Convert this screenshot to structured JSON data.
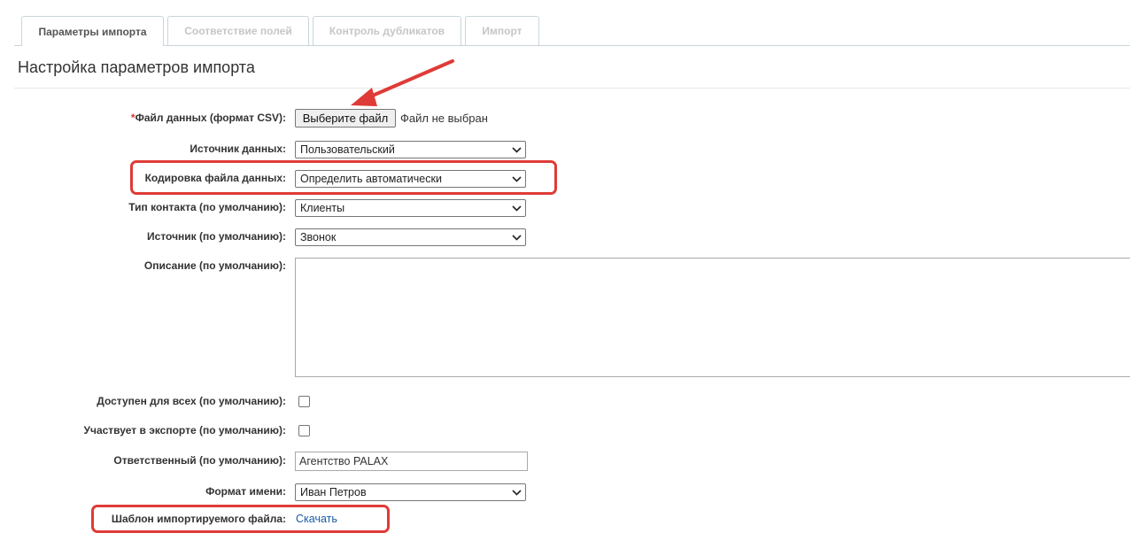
{
  "tabs": [
    {
      "label": "Параметры импорта",
      "active": true
    },
    {
      "label": "Соответствие полей",
      "active": false
    },
    {
      "label": "Контроль дубликатов",
      "active": false
    },
    {
      "label": "Импорт",
      "active": false
    }
  ],
  "page_title": "Настройка параметров импорта",
  "form": {
    "data_file": {
      "required_mark": "*",
      "label": "Файл данных (формат CSV):",
      "button_label": "Выберите файл",
      "status": "Файл не выбран"
    },
    "data_source": {
      "label": "Источник данных:",
      "value": "Пользовательский"
    },
    "encoding": {
      "label": "Кодировка файла данных:",
      "value": "Определить автоматически"
    },
    "contact_type": {
      "label": "Тип контакта (по умолчанию):",
      "value": "Клиенты"
    },
    "source": {
      "label": "Источник (по умолчанию):",
      "value": "Звонок"
    },
    "description": {
      "label": "Описание (по умолчанию):",
      "value": ""
    },
    "available_all": {
      "label": "Доступен для всех (по умолчанию):",
      "checked": false
    },
    "in_export": {
      "label": "Участвует в экспорте (по умолчанию):",
      "checked": false
    },
    "responsible": {
      "label": "Ответственный (по умолчанию):",
      "value": "Агентство PALAX"
    },
    "name_format": {
      "label": "Формат имени:",
      "value": "Иван Петров"
    },
    "template": {
      "label": "Шаблон импортируемого файла:",
      "link": "Скачать"
    }
  },
  "icons": {
    "select_arrow": "chevron-down-icon"
  },
  "colors": {
    "annotation": "#df3b37",
    "link": "#1a5aa6",
    "required": "#e0312a",
    "tab_border": "#c9d6dc"
  }
}
